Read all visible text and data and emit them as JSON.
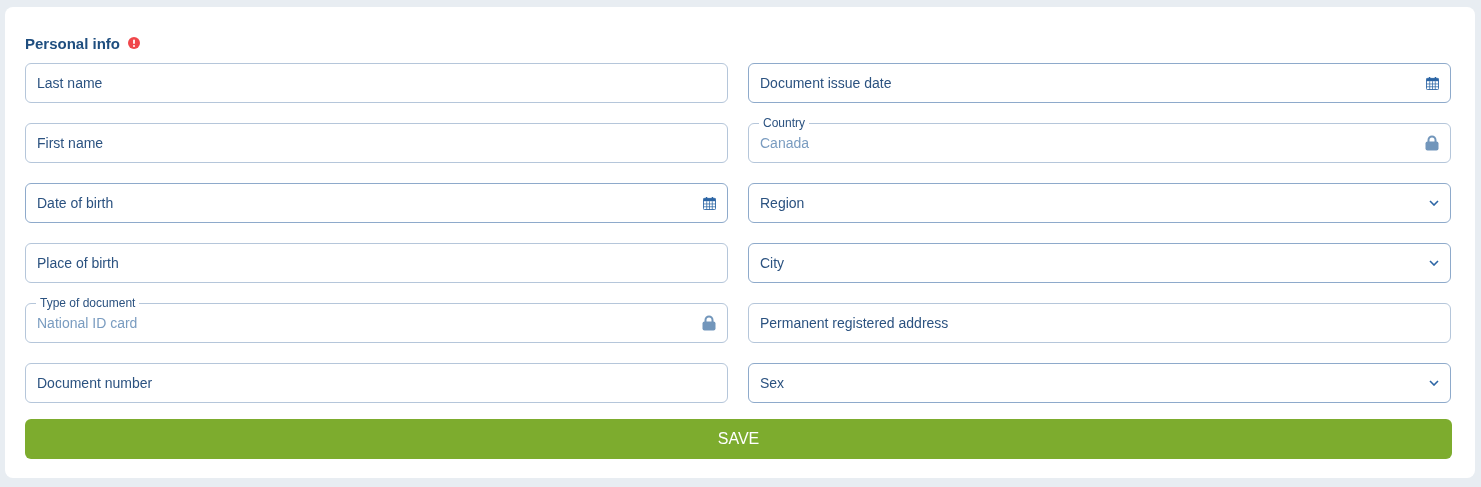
{
  "section": {
    "title": "Personal info",
    "warning": true
  },
  "fields": [
    {
      "kind": "text",
      "placeholder": "Last name"
    },
    {
      "kind": "text",
      "placeholder": "First name"
    },
    {
      "kind": "date",
      "placeholder": "Date of birth"
    },
    {
      "kind": "text",
      "placeholder": "Place of birth"
    },
    {
      "kind": "locked",
      "label": "Type of document",
      "value": "National ID card"
    },
    {
      "kind": "text",
      "placeholder": "Document number"
    },
    {
      "kind": "date",
      "placeholder": "Document issue date"
    },
    {
      "kind": "locked",
      "label": "Country",
      "value": "Canada"
    },
    {
      "kind": "select",
      "placeholder": "Region"
    },
    {
      "kind": "select",
      "placeholder": "City"
    },
    {
      "kind": "text",
      "placeholder": "Permanent registered address"
    },
    {
      "kind": "select",
      "placeholder": "Sex"
    }
  ],
  "save_button": "SAVE"
}
